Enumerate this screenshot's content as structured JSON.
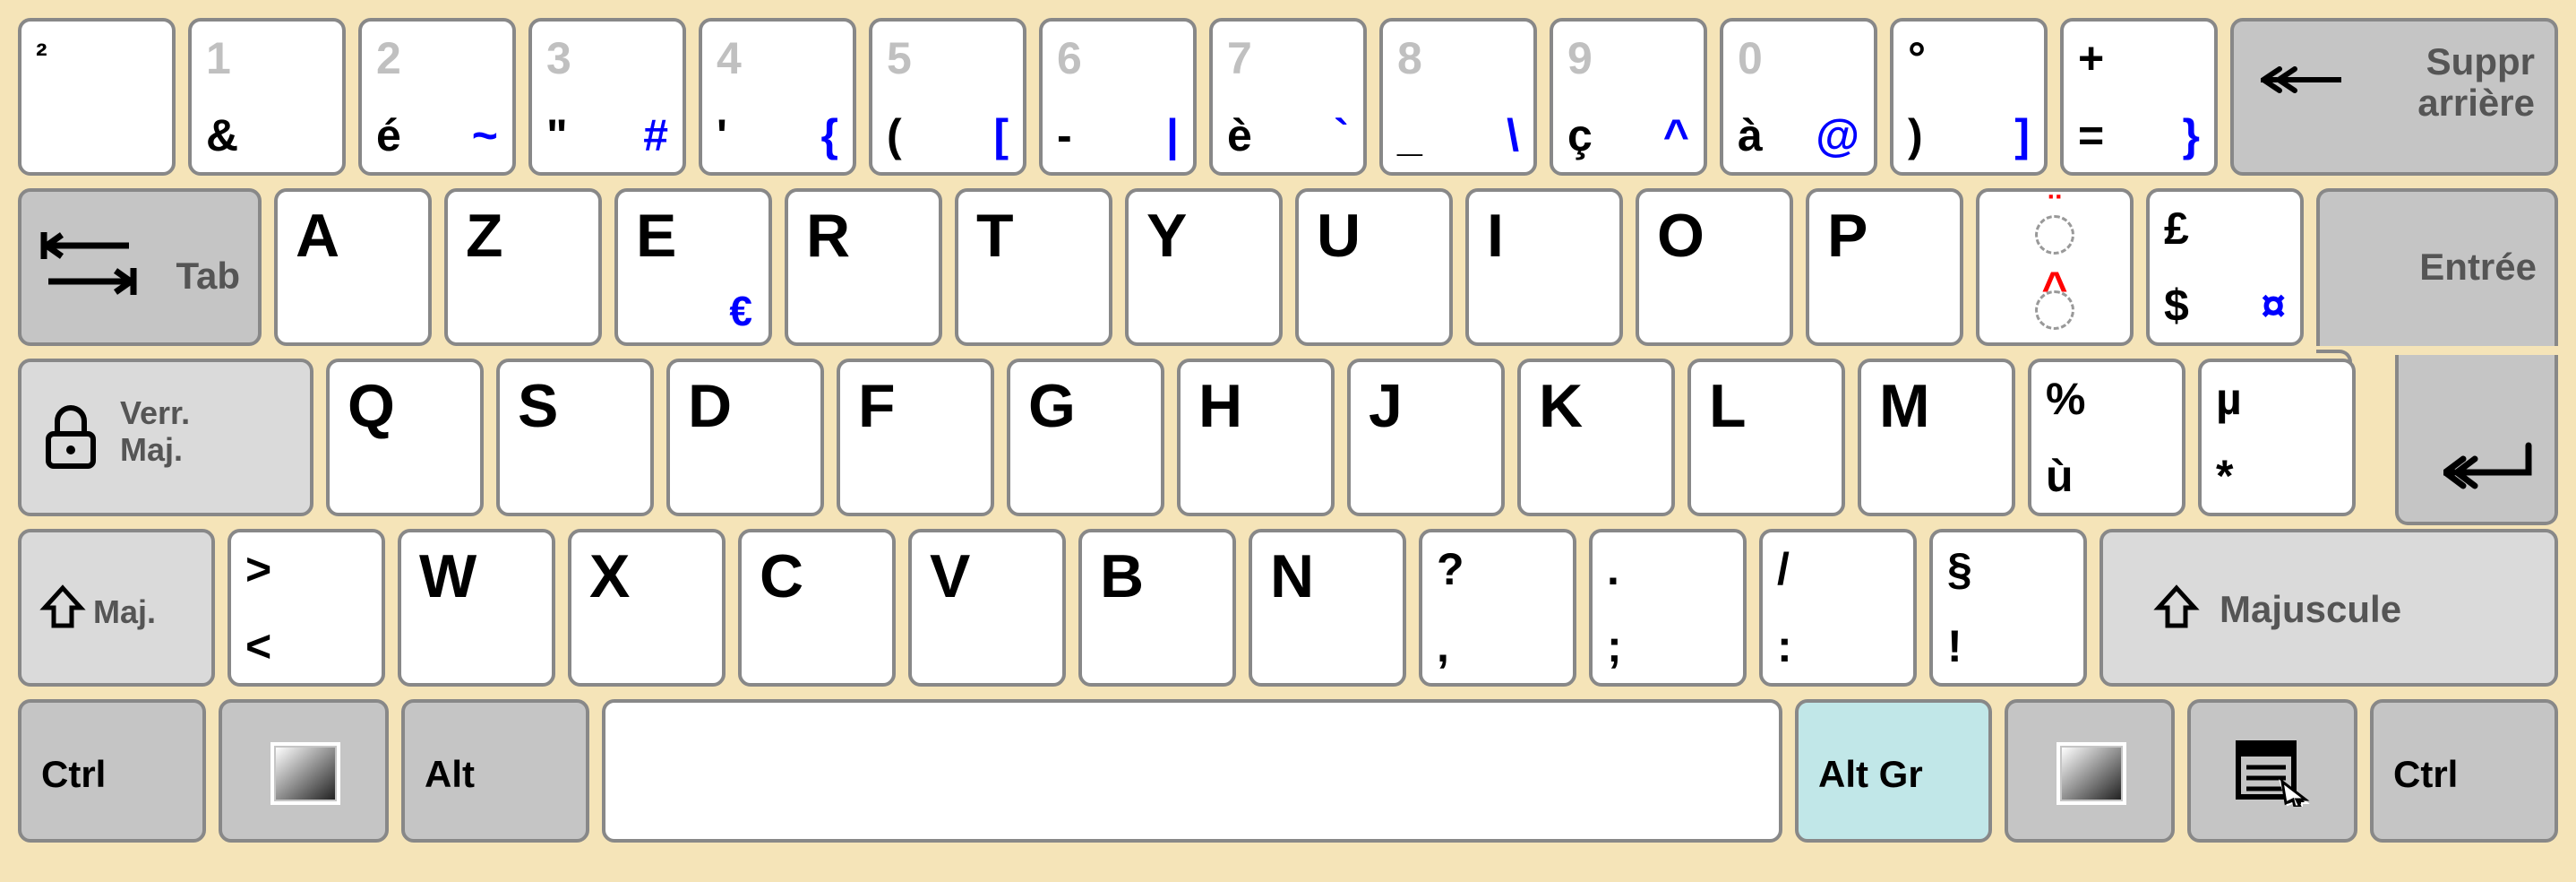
{
  "row1": {
    "k0": {
      "bl": "²"
    },
    "k1": {
      "tl": "1",
      "bl": "&"
    },
    "k2": {
      "tl": "2",
      "bl": "é",
      "br": "~"
    },
    "k3": {
      "tl": "3",
      "bl": "\"",
      "br": "#"
    },
    "k4": {
      "tl": "4",
      "bl": "'",
      "br": "{"
    },
    "k5": {
      "tl": "5",
      "bl": "(",
      "br": "["
    },
    "k6": {
      "tl": "6",
      "bl": "-",
      "br": "|"
    },
    "k7": {
      "tl": "7",
      "bl": "è",
      "br": "`"
    },
    "k8": {
      "tl": "8",
      "bl": "_",
      "br": "\\"
    },
    "k9": {
      "tl": "9",
      "bl": "ç",
      "br": "^"
    },
    "k10": {
      "tl": "0",
      "bl": "à",
      "br": "@"
    },
    "k11": {
      "tl": "°",
      "bl": ")",
      "br": "]"
    },
    "k12": {
      "tl": "+",
      "bl": "=",
      "br": "}"
    },
    "backspace": "Suppr arrière"
  },
  "row2": {
    "tab": "Tab",
    "letters": [
      "A",
      "Z",
      "E",
      "R",
      "T",
      "Y",
      "U",
      "I",
      "O",
      "P"
    ],
    "e_altgr": "€",
    "k11": {
      "tl_dead": "¨",
      "bl_dead": "^"
    },
    "k12": {
      "tl": "£",
      "bl": "$",
      "br": "¤"
    },
    "enter": "Entrée"
  },
  "row3": {
    "caps": "Verr. Maj.",
    "letters": [
      "Q",
      "S",
      "D",
      "F",
      "G",
      "H",
      "J",
      "K",
      "L",
      "M"
    ],
    "k11": {
      "tl": "%",
      "bl": "ù"
    },
    "k12": {
      "tl": "µ",
      "bl": "*"
    }
  },
  "row4": {
    "shift_l": "Maj.",
    "k0": {
      "tl": ">",
      "bl": "<"
    },
    "letters": [
      "W",
      "X",
      "C",
      "V",
      "B",
      "N"
    ],
    "k7": {
      "tl": "?",
      "bl": ","
    },
    "k8": {
      "tl": ".",
      "bl": ";"
    },
    "k9": {
      "tl": "/",
      "bl": ":"
    },
    "k10": {
      "tl": "§",
      "bl": "!"
    },
    "shift_r": "Majuscule"
  },
  "row5": {
    "ctrl_l": "Ctrl",
    "alt": "Alt",
    "altgr": "Alt Gr",
    "ctrl_r": "Ctrl"
  }
}
